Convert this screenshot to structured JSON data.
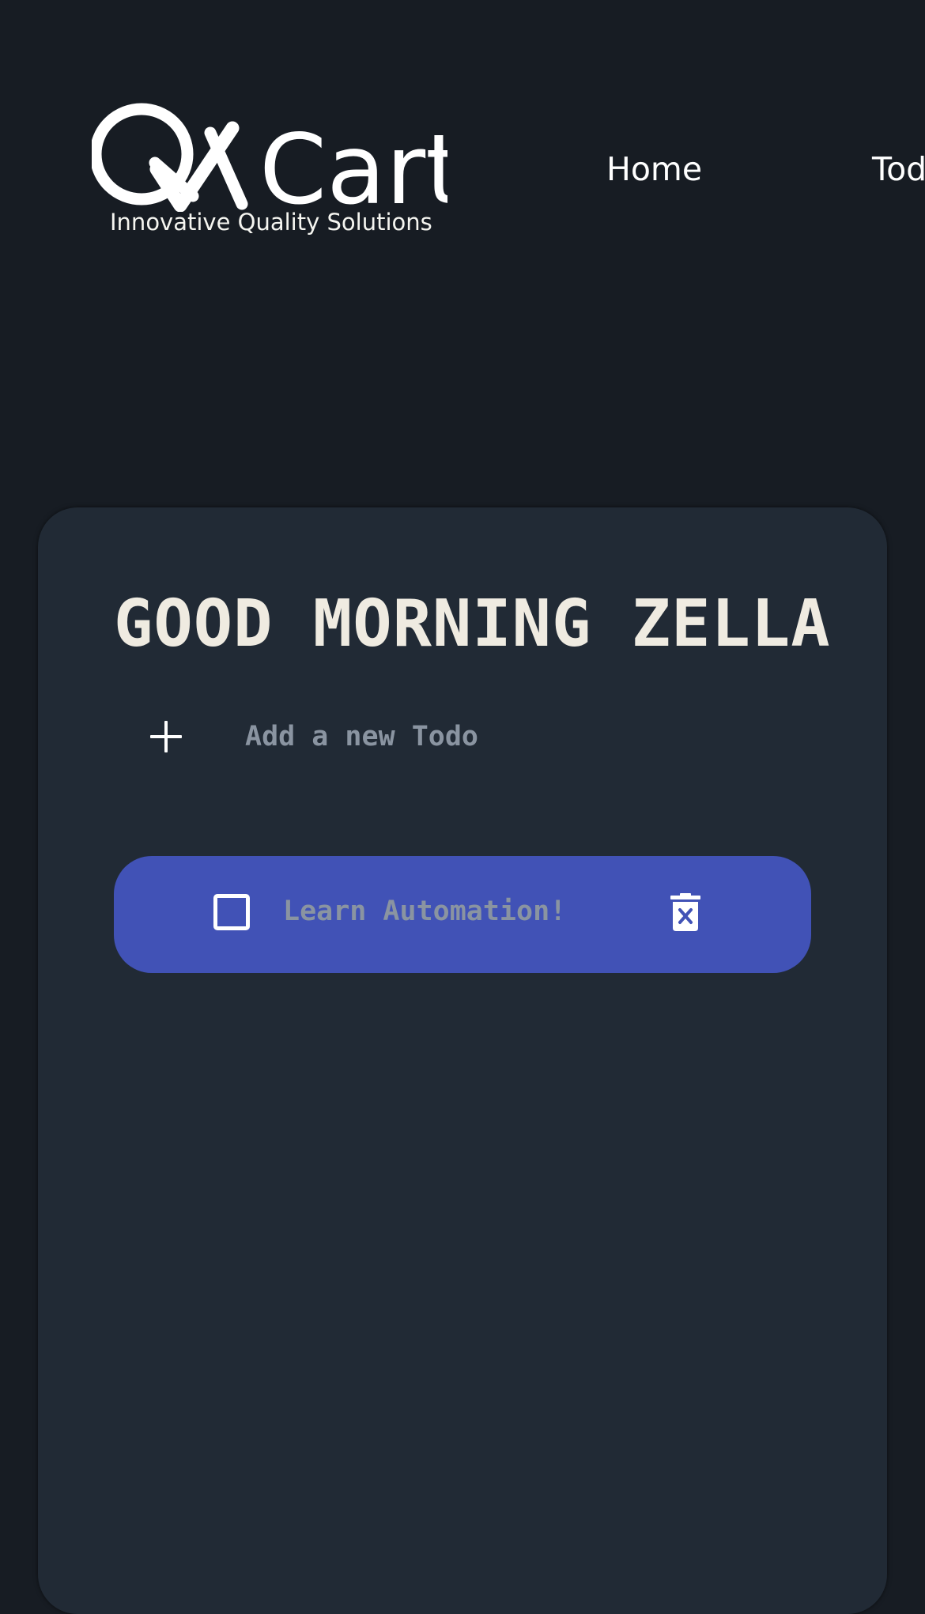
{
  "brand": {
    "logo_text": "QACart",
    "tagline": "Innovative Quality Solutions"
  },
  "nav": {
    "home_label": "Home",
    "todo_label": "Todo"
  },
  "todo_page": {
    "greeting": "GOOD MORNING ZELLA",
    "add_placeholder": "Add a new Todo",
    "add_icon": "plus-icon",
    "items": [
      {
        "text": "Learn Automation!",
        "completed": false,
        "checkbox_icon": "checkbox-empty-icon",
        "delete_icon": "trash-icon"
      }
    ]
  },
  "colors": {
    "page_background": "#171c23",
    "card_background": "#212a35",
    "item_background": "#4152b6",
    "greeting_text": "#efebe1",
    "muted_text": "#8a94a1",
    "white": "#ffffff"
  }
}
